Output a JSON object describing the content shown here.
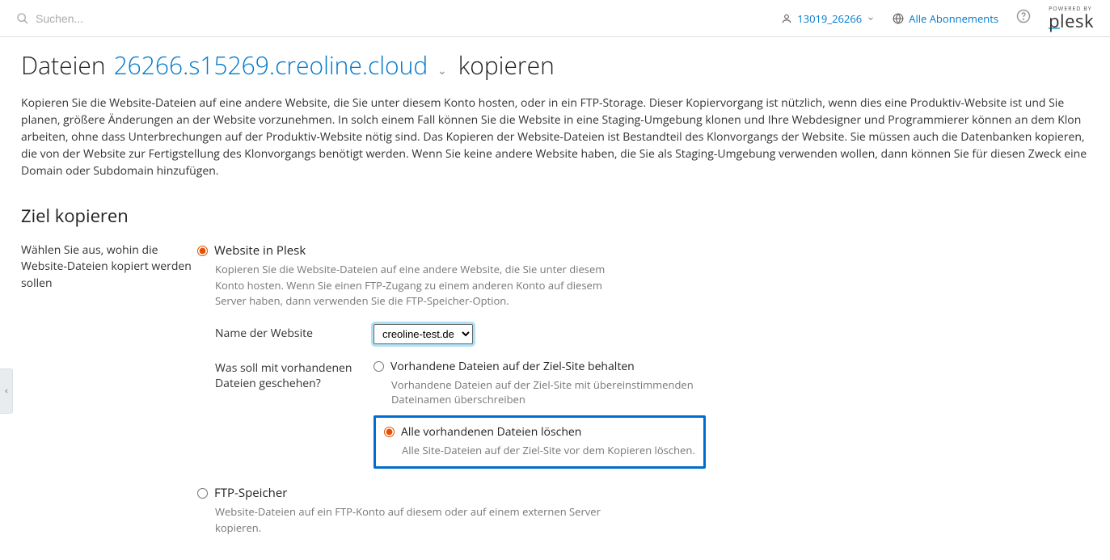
{
  "topbar": {
    "search_placeholder": "Suchen...",
    "user_label": "13019_26266",
    "subscriptions_label": "Alle Abonnements",
    "brand_small": "POWERED BY",
    "brand_big_underlined": "p",
    "brand_big_rest": "lesk"
  },
  "page": {
    "title_prefix": "Dateien",
    "domain": "26266.s15269.creoline.cloud",
    "title_suffix": "kopieren",
    "intro": "Kopieren Sie die Website-Dateien auf eine andere Website, die Sie unter diesem Konto hosten, oder in ein FTP-Storage. Dieser Kopiervorgang ist nützlich, wenn dies eine Produktiv-Website ist und Sie planen, größere Änderungen an der Website vorzunehmen. In solch einem Fall können Sie die Website in eine Staging-Umgebung klonen und Ihre Webdesigner und Programmierer können an dem Klon arbeiten, ohne dass Unterbrechungen auf der Produktiv-Website nötig sind. Das Kopieren der Website-Dateien ist Bestandteil des Klonvorgangs der Website. Sie müssen auch die Datenbanken kopieren, die von der Website zur Fertigstellung des Klonvorgangs benötigt werden. Wenn Sie keine andere Website haben, die Sie als Staging-Umgebung verwenden wollen, dann können Sie für diesen Zweck eine Domain oder Subdomain hinzufügen."
  },
  "section": {
    "heading": "Ziel kopieren",
    "side_label": "Wählen Sie aus, wohin die Website-Dateien kopiert werden sollen"
  },
  "target": {
    "plesk": {
      "label": "Website in Plesk",
      "desc": "Kopieren Sie die Website-Dateien auf eine andere Website, die Sie unter diesem Konto hosten. Wenn Sie einen FTP-Zugang zu einem anderen Konto auf diesem Server haben, dann verwenden Sie die FTP-Speicher-Option.",
      "site_name_label": "Name der Website",
      "site_select_value": "creoline-test.de",
      "existing_label": "Was soll mit vorhandenen Dateien geschehen?",
      "keep": {
        "label": "Vorhandene Dateien auf der Ziel-Site behalten",
        "desc": "Vorhandene Dateien auf der Ziel-Site mit übereinstimmenden Dateinamen überschreiben"
      },
      "delete": {
        "label": "Alle vorhandenen Dateien löschen",
        "desc": "Alle Site-Dateien auf der Ziel-Site vor dem Kopieren löschen."
      }
    },
    "ftp": {
      "label": "FTP-Speicher",
      "desc": "Website-Dateien auf ein FTP-Konto auf diesem oder auf einem externen Server kopieren."
    }
  }
}
